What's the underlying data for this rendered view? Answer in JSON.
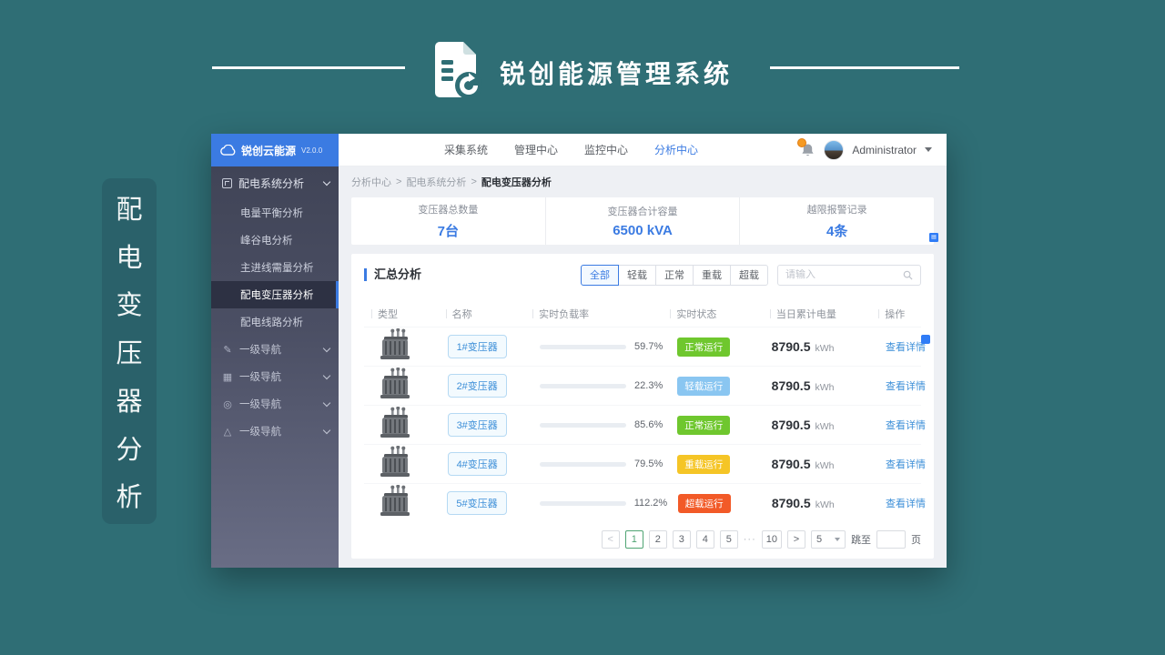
{
  "banner": {
    "title": "锐创能源管理系统",
    "icon": "document-refresh-icon"
  },
  "vertical_label": [
    "配",
    "电",
    "变",
    "压",
    "器",
    "分",
    "析"
  ],
  "app": {
    "logo": {
      "name": "锐创云能源",
      "version": "V2.0.0"
    },
    "topnav": {
      "items": [
        "采集系统",
        "管理中心",
        "监控中心",
        "分析中心"
      ],
      "active": "分析中心"
    },
    "user": {
      "name": "Administrator"
    },
    "sidebar": {
      "group_label": "配电系统分析",
      "children": [
        "电量平衡分析",
        "峰谷电分析",
        "主进线需量分析",
        "配电变压器分析",
        "配电线路分析"
      ],
      "active_child": "配电变压器分析",
      "nav_groups": [
        "一级导航",
        "一级导航",
        "一级导航",
        "一级导航"
      ]
    },
    "breadcrumb": {
      "items": [
        "分析中心",
        "配电系统分析",
        "配电变压器分析"
      ],
      "separator": ">"
    },
    "stats": [
      {
        "label": "变压器总数量",
        "value": "7台"
      },
      {
        "label": "变压器合计容量",
        "value": "6500 kVA"
      },
      {
        "label": "越限报警记录",
        "value": "4条"
      }
    ],
    "panel": {
      "title": "汇总分析",
      "filters": [
        "全部",
        "轻载",
        "正常",
        "重载",
        "超载"
      ],
      "active_filter": "全部",
      "search_placeholder": "请输入",
      "table": {
        "headers": [
          "类型",
          "名称",
          "实时负载率",
          "实时状态",
          "当日累计电量",
          "操作"
        ],
        "rows": [
          {
            "name": "1#变压器",
            "load_label": "59.7%",
            "load_value": 59.7,
            "status": "正常运行",
            "status_type": "normal",
            "energy": "8790.5",
            "unit": "kWh",
            "action": "查看详情"
          },
          {
            "name": "2#变压器",
            "load_label": "22.3%",
            "load_value": 22.3,
            "status": "轻载运行",
            "status_type": "light",
            "energy": "8790.5",
            "unit": "kWh",
            "action": "查看详情"
          },
          {
            "name": "3#变压器",
            "load_label": "85.6%",
            "load_value": 85.6,
            "status": "正常运行",
            "status_type": "normal",
            "energy": "8790.5",
            "unit": "kWh",
            "action": "查看详情"
          },
          {
            "name": "4#变压器",
            "load_label": "79.5%",
            "load_value": 79.5,
            "status": "重载运行",
            "status_type": "heavy",
            "energy": "8790.5",
            "unit": "kWh",
            "action": "查看详情"
          },
          {
            "name": "5#变压器",
            "load_label": "112.2%",
            "load_value": 112.2,
            "status": "超载运行",
            "status_type": "over",
            "energy": "8790.5",
            "unit": "kWh",
            "action": "查看详情"
          }
        ]
      },
      "pagination": {
        "prev": "<",
        "pages": [
          "1",
          "2",
          "3",
          "4",
          "5",
          "···",
          "10"
        ],
        "active_page": "1",
        "next": ">",
        "page_size": "5",
        "jump_label": "跳至",
        "jump_unit": "页"
      }
    }
  },
  "colors": {
    "background_teal": "#2f6e75",
    "accent_blue": "#3b7be2",
    "progress_blue": "#2f7cf6",
    "status_normal_green": "#6fc72e",
    "status_light_blue": "#8ac6f1",
    "status_heavy_yellow": "#f5c526",
    "status_over_orange": "#f25a28",
    "notification_orange": "#f59a23",
    "pager_active_green": "#4fa473"
  }
}
